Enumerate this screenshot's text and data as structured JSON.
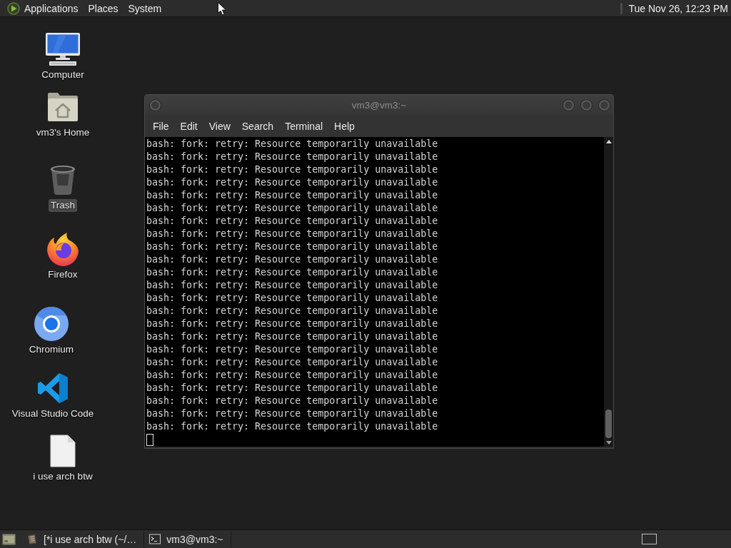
{
  "top_panel": {
    "menus": [
      "Applications",
      "Places",
      "System"
    ],
    "clock": "Tue Nov 26, 12:23 PM"
  },
  "desktop_icons": [
    {
      "kind": "computer",
      "label": "Computer",
      "selected": false
    },
    {
      "kind": "home",
      "label": "vm3's Home",
      "selected": false
    },
    {
      "kind": "trash",
      "label": "Trash",
      "selected": true
    },
    {
      "kind": "firefox",
      "label": "Firefox",
      "selected": false
    },
    {
      "kind": "chromium",
      "label": "Chromium",
      "selected": false
    },
    {
      "kind": "vscode",
      "label": "Visual Studio Code",
      "selected": false
    },
    {
      "kind": "file",
      "label": "i use arch btw",
      "selected": false
    }
  ],
  "terminal": {
    "title": "vm3@vm3:~",
    "menu": [
      "File",
      "Edit",
      "View",
      "Search",
      "Terminal",
      "Help"
    ],
    "lines": [
      "bash: fork: retry: Resource temporarily unavailable",
      "bash: fork: retry: Resource temporarily unavailable",
      "bash: fork: retry: Resource temporarily unavailable",
      "bash: fork: retry: Resource temporarily unavailable",
      "bash: fork: retry: Resource temporarily unavailable",
      "bash: fork: retry: Resource temporarily unavailable",
      "bash: fork: retry: Resource temporarily unavailable",
      "bash: fork: retry: Resource temporarily unavailable",
      "bash: fork: retry: Resource temporarily unavailable",
      "bash: fork: retry: Resource temporarily unavailable",
      "bash: fork: retry: Resource temporarily unavailable",
      "bash: fork: retry: Resource temporarily unavailable",
      "bash: fork: retry: Resource temporarily unavailable",
      "bash: fork: retry: Resource temporarily unavailable",
      "bash: fork: retry: Resource temporarily unavailable",
      "bash: fork: retry: Resource temporarily unavailable",
      "bash: fork: retry: Resource temporarily unavailable",
      "bash: fork: retry: Resource temporarily unavailable",
      "bash: fork: retry: Resource temporarily unavailable",
      "bash: fork: retry: Resource temporarily unavailable",
      "bash: fork: retry: Resource temporarily unavailable",
      "bash: fork: retry: Resource temporarily unavailable",
      "bash: fork: retry: Resource temporarily unavailable"
    ]
  },
  "taskbar": {
    "tasks": [
      {
        "kind": "editor",
        "label": "[*i use arch btw (~/…"
      },
      {
        "kind": "terminal",
        "label": "vm3@vm3:~"
      }
    ]
  }
}
